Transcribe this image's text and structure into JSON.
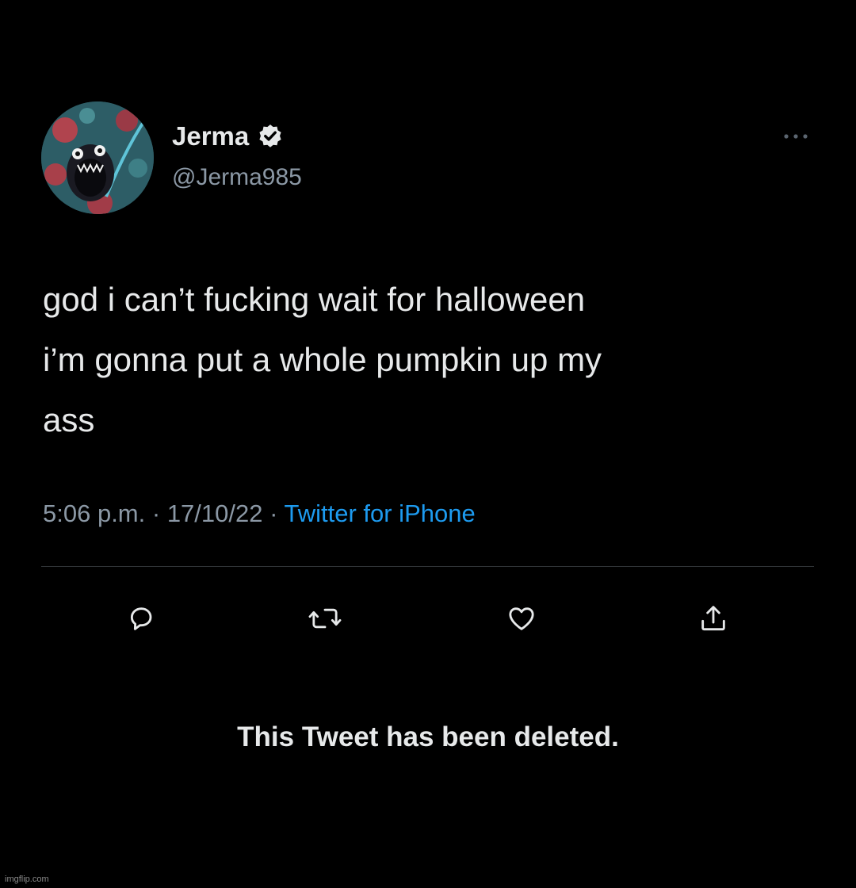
{
  "tweet": {
    "author": {
      "display_name": "Jerma",
      "handle": "@Jerma985",
      "verified": true
    },
    "text_lines": [
      "god i can’t fucking wait for halloween",
      "i’m gonna put a whole pumpkin up my",
      "ass"
    ],
    "time": "5:06 p.m.",
    "separator": " · ",
    "date": "17/10/22",
    "source": "Twitter for iPhone"
  },
  "actions": {
    "reply_icon": "reply-icon",
    "retweet_icon": "retweet-icon",
    "like_icon": "heart-icon",
    "share_icon": "share-icon"
  },
  "notice": "This Tweet has been deleted.",
  "watermark": "imgflip.com",
  "colors": {
    "background": "#000000",
    "primary_text": "#e7e9ea",
    "secondary_text": "#8b98a5",
    "link": "#1d9bf0",
    "divider": "#2f3336"
  }
}
